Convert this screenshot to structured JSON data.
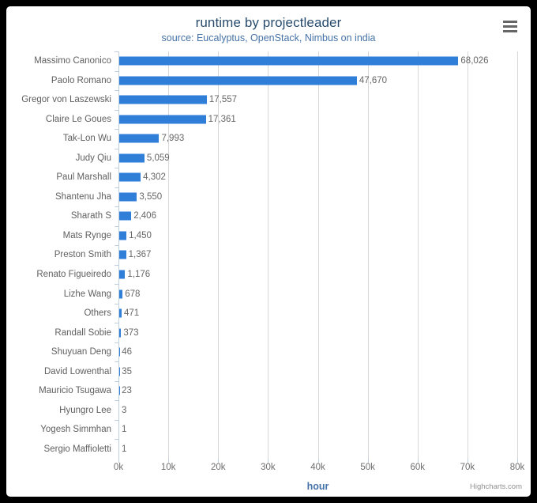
{
  "chart_data": {
    "type": "bar",
    "orientation": "horizontal",
    "title": "runtime by projectleader",
    "subtitle": "source: Eucalyptus, OpenStack, Nimbus on india",
    "xlabel": "hour",
    "ylabel": "",
    "xlim": [
      0,
      80000
    ],
    "xticks": [
      "0k",
      "10k",
      "20k",
      "30k",
      "40k",
      "50k",
      "60k",
      "70k",
      "80k"
    ],
    "xtick_values": [
      0,
      10000,
      20000,
      30000,
      40000,
      50000,
      60000,
      70000,
      80000
    ],
    "grid": true,
    "legend": false,
    "series_color": "#2f7ed8",
    "categories": [
      "Massimo Canonico",
      "Paolo Romano",
      "Gregor von Laszewski",
      "Claire Le Goues",
      "Tak-Lon Wu",
      "Judy Qiu",
      "Paul Marshall",
      "Shantenu Jha",
      "Sharath S",
      "Mats Rynge",
      "Preston Smith",
      "Renato Figueiredo",
      "Lizhe Wang",
      "Others",
      "Randall Sobie",
      "Shuyuan Deng",
      "David Lowenthal",
      "Mauricio Tsugawa",
      "Hyungro Lee",
      "Yogesh Simmhan",
      "Sergio Maffioletti"
    ],
    "values": [
      68026,
      47670,
      17557,
      17361,
      7993,
      5059,
      4302,
      3550,
      2406,
      1450,
      1367,
      1176,
      678,
      471,
      373,
      46,
      35,
      23,
      3,
      1,
      1
    ],
    "value_labels": [
      "68,026",
      "47,670",
      "17,557",
      "17,361",
      "7,993",
      "5,059",
      "4,302",
      "3,550",
      "2,406",
      "1,450",
      "1,367",
      "1,176",
      "678",
      "471",
      "373",
      "46",
      "35",
      "23",
      "3",
      "1",
      "1"
    ]
  },
  "toolbar": {
    "context_menu_label": "Chart context menu"
  },
  "credits": {
    "text": "Highcharts.com"
  }
}
